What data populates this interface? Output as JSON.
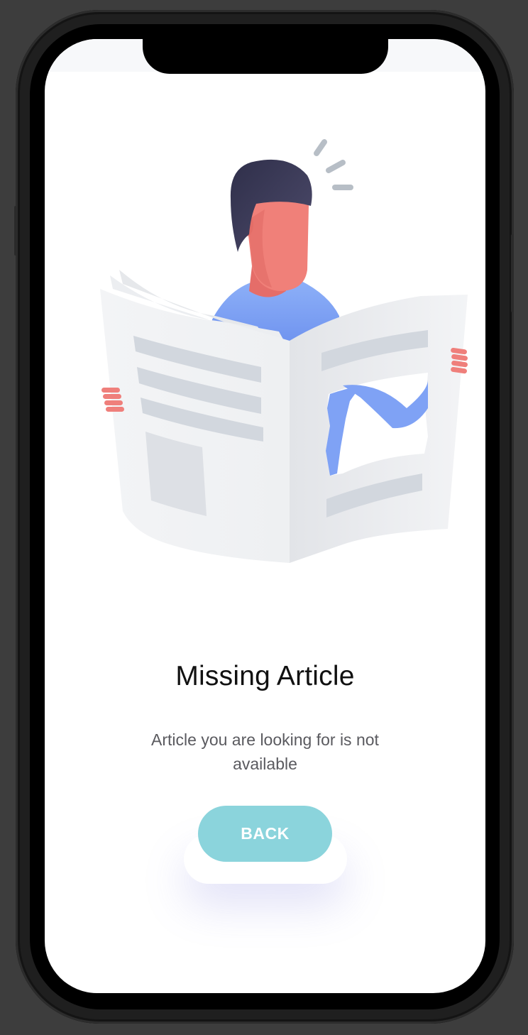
{
  "screen": {
    "title": "Missing Article",
    "message": "Article you are looking for is not available",
    "back_label": "BACK"
  },
  "colors": {
    "button": "#8bd4dc",
    "hair": "#3a3a58",
    "skin": "#f08079",
    "shirt": "#7fa2f5",
    "paper": "#f0f1f3",
    "paper_lines": "#d2d7de"
  },
  "icons": [
    "reader-illustration",
    "surprise-marks-icon",
    "newspaper-icon"
  ]
}
